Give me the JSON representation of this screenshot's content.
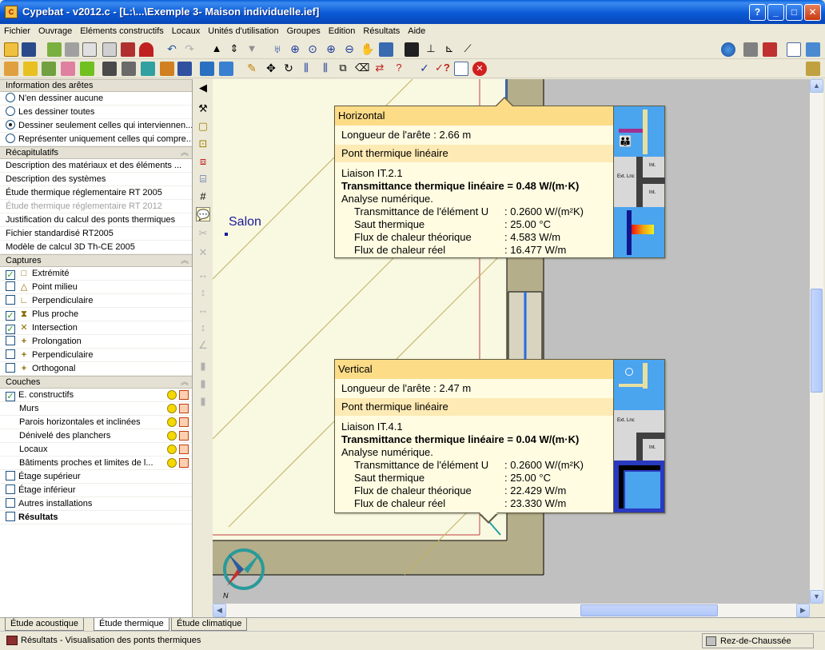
{
  "window": {
    "title": "Cypebat  - v2012.c - [L:\\...\\Exemple 3- Maison individuelle.ief]",
    "app_icon": "cype-app-icon",
    "btn_help": "?",
    "btn_min": "_",
    "btn_max": "□",
    "btn_close": "✕"
  },
  "menu": [
    "Fichier",
    "Ouvrage",
    "Eléments constructifs",
    "Locaux",
    "Unités d'utilisation",
    "Groupes",
    "Edition",
    "Résultats",
    "Aide"
  ],
  "panel": {
    "edges": {
      "title": "Information des arêtes",
      "options": [
        {
          "label": "N'en dessiner aucune",
          "selected": false
        },
        {
          "label": "Les dessiner toutes",
          "selected": false
        },
        {
          "label": "Dessiner seulement celles qui interviennen...",
          "selected": true
        },
        {
          "label": "Représenter uniquement celles qui compre...",
          "selected": false
        }
      ]
    },
    "summaries": {
      "title": "Récapitulatifs",
      "items": [
        {
          "label": "Description des matériaux et des éléments ...",
          "enabled": true
        },
        {
          "label": "Description des systèmes",
          "enabled": true
        },
        {
          "label": "Étude thermique réglementaire RT 2005",
          "enabled": true
        },
        {
          "label": "Étude thermique réglementaire RT 2012",
          "enabled": false
        },
        {
          "label": "Justification du calcul des ponts thermiques",
          "enabled": true
        },
        {
          "label": "Fichier standardisé RT2005",
          "enabled": true
        },
        {
          "label": "Modèle de calcul 3D Th-CE 2005",
          "enabled": true
        }
      ]
    },
    "captures": {
      "title": "Captures",
      "items": [
        {
          "label": "Extrémité",
          "checked": true,
          "symbol": "□"
        },
        {
          "label": "Point milieu",
          "checked": false,
          "symbol": "△"
        },
        {
          "label": "Perpendiculaire",
          "checked": false,
          "symbol": "∟"
        },
        {
          "label": "Plus proche",
          "checked": true,
          "symbol": "⧗"
        },
        {
          "label": "Intersection",
          "checked": true,
          "symbol": "✕"
        },
        {
          "label": "Prolongation",
          "checked": false,
          "symbol": "+"
        },
        {
          "label": "Perpendiculaire",
          "checked": false,
          "symbol": "+"
        },
        {
          "label": "Orthogonal",
          "checked": false,
          "symbol": "+"
        }
      ]
    },
    "layers": {
      "title": "Couches",
      "items": [
        {
          "label": "E. constructifs",
          "checked": true,
          "checkbox": true,
          "icons": true
        },
        {
          "label": "Murs",
          "checkbox": false,
          "icons": true
        },
        {
          "label": "Parois horizontales et inclinées",
          "checkbox": false,
          "icons": true
        },
        {
          "label": "Dénivelé des planchers",
          "checkbox": false,
          "icons": true
        },
        {
          "label": "Locaux",
          "checkbox": false,
          "icons": true
        },
        {
          "label": "Bâtiments proches et limites de l...",
          "checkbox": false,
          "icons": true
        },
        {
          "label": "Étage supérieur",
          "checked": false,
          "checkbox": true,
          "icons": false
        },
        {
          "label": "Étage inférieur",
          "checked": false,
          "checkbox": true,
          "icons": false
        },
        {
          "label": "Autres installations",
          "checked": false,
          "checkbox": true,
          "icons": false
        }
      ]
    },
    "results": {
      "label": "Résultats",
      "checked": false
    }
  },
  "canvas": {
    "room_label": "Salon",
    "compass_letter": "N"
  },
  "tooltip_horizontal": {
    "title": "Horizontal",
    "length_line": "Longueur de l'arête : 2.66 m",
    "section": "Pont thermique linéaire",
    "liaison": "Liaison IT.2.1",
    "transmittance_total": "Transmittance thermique linéaire = 0.48 W/(m·K)",
    "analysis": "Analyse numérique.",
    "rows": [
      {
        "k": "Transmittance de l'élément U",
        "v": ": 0.2600 W/(m²K)"
      },
      {
        "k": "Saut thermique",
        "v": ": 25.00 °C"
      },
      {
        "k": "Flux de chaleur théorique",
        "v": ": 4.583 W/m"
      },
      {
        "k": "Flux de chaleur réel",
        "v": ": 16.477 W/m"
      }
    ],
    "pic_text": {
      "ext": "Ext. Lnc",
      "int_top": "Int.",
      "int_bottom": "Int."
    }
  },
  "tooltip_vertical": {
    "title": "Vertical",
    "length_line": "Longueur de l'arête : 2.47 m",
    "section": "Pont thermique linéaire",
    "liaison": "Liaison IT.4.1",
    "transmittance_total": "Transmittance thermique linéaire = 0.04 W/(m·K)",
    "analysis": "Analyse numérique.",
    "rows": [
      {
        "k": "Transmittance de l'élément U",
        "v": ": 0.2600 W/(m²K)"
      },
      {
        "k": "Saut thermique",
        "v": ": 25.00 °C"
      },
      {
        "k": "Flux de chaleur théorique",
        "v": ": 22.429 W/m"
      },
      {
        "k": "Flux de chaleur réel",
        "v": ": 23.330 W/m"
      }
    ],
    "pic_text": {
      "ext": "Ext. Lnc",
      "int": "Int."
    }
  },
  "tabs": [
    {
      "label": "Étude acoustique",
      "active": false
    },
    {
      "label": "Étude thermique",
      "active": true
    },
    {
      "label": "Étude climatique",
      "active": false
    }
  ],
  "status": {
    "message": "Résultats - Visualisation des ponts thermiques",
    "floor": "Rez-de-Chaussée"
  }
}
